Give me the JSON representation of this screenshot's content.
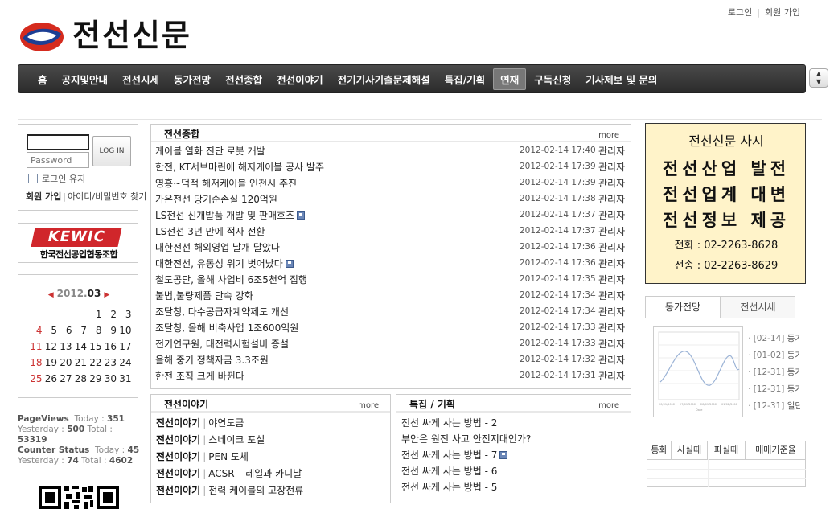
{
  "top_links": {
    "login": "로그인",
    "join": "회원 가입"
  },
  "site": {
    "name": "전선신문"
  },
  "nav": {
    "items": [
      "홈",
      "공지및안내",
      "전선시세",
      "동가전망",
      "전선종합",
      "전선이야기",
      "전기기사기출문제해설",
      "특집/기획",
      "연재",
      "구독신청",
      "기사제보 및 문의"
    ],
    "active_index": 8
  },
  "login": {
    "password_placeholder": "Password",
    "button": "LOG IN",
    "keep_login": "로그인 유지",
    "signup": "회원 가입",
    "find": "아이디/비밀번호 찾기"
  },
  "banner": {
    "logo_text": "KEWIC",
    "org_name": "한국전선공업협동조합"
  },
  "calendar": {
    "year": "2012.",
    "month": "03",
    "weeks": [
      [
        "",
        "",
        "",
        "",
        "1",
        "2",
        "3"
      ],
      [
        "4",
        "5",
        "6",
        "7",
        "8",
        "9",
        "10"
      ],
      [
        "11",
        "12",
        "13",
        "14",
        "15",
        "16",
        "17"
      ],
      [
        "18",
        "19",
        "20",
        "21",
        "22",
        "23",
        "24"
      ],
      [
        "25",
        "26",
        "27",
        "28",
        "29",
        "30",
        "31"
      ]
    ]
  },
  "stats": {
    "pageviews_label": "PageViews",
    "today_label": "Today :",
    "pv_today": "351",
    "yesterday_label": "Yesterday :",
    "pv_yesterday": "500",
    "total_label": "Total :",
    "pv_total": "53319",
    "counter_label": "Counter Status",
    "cs_today": "45",
    "cs_yesterday": "74",
    "cs_total": "4602"
  },
  "news": {
    "title": "전선종합",
    "more": "more",
    "items": [
      {
        "title": "케이블 열화 진단 로봇 개발",
        "date": "2012-02-14",
        "time": "17:40",
        "author": "관리자",
        "file": false
      },
      {
        "title": "한전, KT서브마린에 해저케이블 공사 발주",
        "date": "2012-02-14",
        "time": "17:39",
        "author": "관리자",
        "file": false
      },
      {
        "title": "영흥~덕적 해저케이블 인천시 추진",
        "date": "2012-02-14",
        "time": "17:39",
        "author": "관리자",
        "file": false
      },
      {
        "title": "가온전선 당기순손실 120억원",
        "date": "2012-02-14",
        "time": "17:38",
        "author": "관리자",
        "file": false
      },
      {
        "title": "LS전선 신개발품 개발 및 판매호조",
        "date": "2012-02-14",
        "time": "17:37",
        "author": "관리자",
        "file": true
      },
      {
        "title": "LS전선 3년 만에 적자 전환",
        "date": "2012-02-14",
        "time": "17:37",
        "author": "관리자",
        "file": false
      },
      {
        "title": "대한전선 해외영업 날개 달았다",
        "date": "2012-02-14",
        "time": "17:36",
        "author": "관리자",
        "file": false
      },
      {
        "title": "대한전선, 유동성 위기 벗어났다",
        "date": "2012-02-14",
        "time": "17:36",
        "author": "관리자",
        "file": true
      },
      {
        "title": "철도공단, 올해 사업비 6조5천억 집행",
        "date": "2012-02-14",
        "time": "17:35",
        "author": "관리자",
        "file": false
      },
      {
        "title": "불법,불량제품 단속 강화",
        "date": "2012-02-14",
        "time": "17:34",
        "author": "관리자",
        "file": false
      },
      {
        "title": "조달청, 다수공급자계약제도 개선",
        "date": "2012-02-14",
        "time": "17:34",
        "author": "관리자",
        "file": false
      },
      {
        "title": "조달청, 올해 비축사업 1조600억원",
        "date": "2012-02-14",
        "time": "17:33",
        "author": "관리자",
        "file": false
      },
      {
        "title": "전기연구원, 대전력시험설비 증설",
        "date": "2012-02-14",
        "time": "17:33",
        "author": "관리자",
        "file": false
      },
      {
        "title": "올해 중기 정책자금 3.3조원",
        "date": "2012-02-14",
        "time": "17:32",
        "author": "관리자",
        "file": false
      },
      {
        "title": "한전 조직 크게 바뀐다",
        "date": "2012-02-14",
        "time": "17:31",
        "author": "관리자",
        "file": false
      }
    ]
  },
  "story": {
    "title": "전선이야기",
    "more": "more",
    "items": [
      {
        "cat": "전선이야기",
        "title": "야연도금"
      },
      {
        "cat": "전선이야기",
        "title": "스네이크 포설"
      },
      {
        "cat": "전선이야기",
        "title": "PEN 도체"
      },
      {
        "cat": "전선이야기",
        "title": "ACSR – 레일과 카디날"
      },
      {
        "cat": "전선이야기",
        "title": "전력 케이블의 고장전류"
      }
    ]
  },
  "feature": {
    "title": "특집 / 기획",
    "more": "more",
    "items": [
      {
        "title": "전선 싸게 사는 방법 - 2",
        "file": false
      },
      {
        "title": "부안은 원전 사고 안전지대인가?",
        "file": false
      },
      {
        "title": "전선 싸게 사는 방법 - 7",
        "file": true
      },
      {
        "title": "전선 싸게 사는 방법 - 6",
        "file": false
      },
      {
        "title": "전선 싸게 사는 방법 - 5",
        "file": false
      }
    ]
  },
  "ad": {
    "line1": "전선신문 사시",
    "motto": [
      "전선산업 발전",
      "전선업계 대변",
      "전선정보 제공"
    ],
    "phone": "전화 : 02-2263-8628",
    "fax": "전송 : 02-2263-8629"
  },
  "copper_tabs": {
    "tab1": "동가전망",
    "tab2": "전선시세"
  },
  "chart_links": [
    {
      "date": "[02-14]",
      "text": "동가"
    },
    {
      "date": "[01-02]",
      "text": "동가"
    },
    {
      "date": "[12-31]",
      "text": "동가"
    },
    {
      "date": "[12-31]",
      "text": "동가"
    },
    {
      "date": "[12-31]",
      "text": "일단"
    }
  ],
  "rate_table": {
    "headers": [
      "통화",
      "사실때",
      "파실때",
      "매매기준율"
    ]
  }
}
